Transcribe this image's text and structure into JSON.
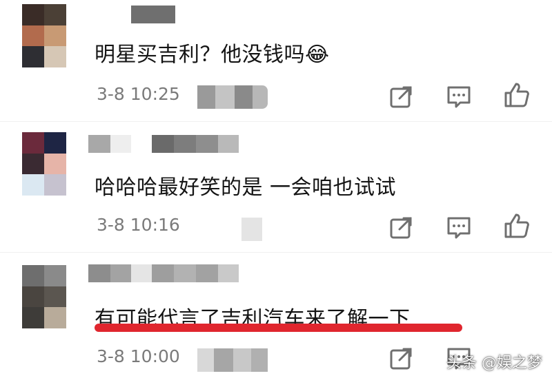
{
  "comments": [
    {
      "text": "明星买吉利？他没钱吗😂",
      "time": "3-8 10:25",
      "avatar_colors": [
        "#3a2c27",
        "#4b4036",
        "#b26b4d",
        "#c89a74",
        "#2e2e33",
        "#d6c7b5"
      ]
    },
    {
      "text": "哈哈哈最好笑的是 一会咱也试试",
      "time": "3-8 10:16",
      "avatar_colors": [
        "#6b2a3c",
        "#1e2544",
        "#3a2a32",
        "#e6b4a8",
        "#dbe8f2",
        "#c6c2cf"
      ]
    },
    {
      "text": "有可能代言了吉利汽车来了解一下",
      "time": "3-8 10:00",
      "avatar_colors": [
        "#6e6e6e",
        "#8a8a8a",
        "#4a4540",
        "#5b5650",
        "#3e3c39",
        "#b8ab9a"
      ]
    }
  ],
  "actions": {
    "share_icon": "share-icon",
    "reply_icon": "comment-icon",
    "like_icon": "thumbs-up-icon"
  },
  "watermark": "头条 @娱之梦",
  "colors": {
    "underline": "#e0262e",
    "meta": "#7a7a7a",
    "icon": "#6f6f6f"
  }
}
